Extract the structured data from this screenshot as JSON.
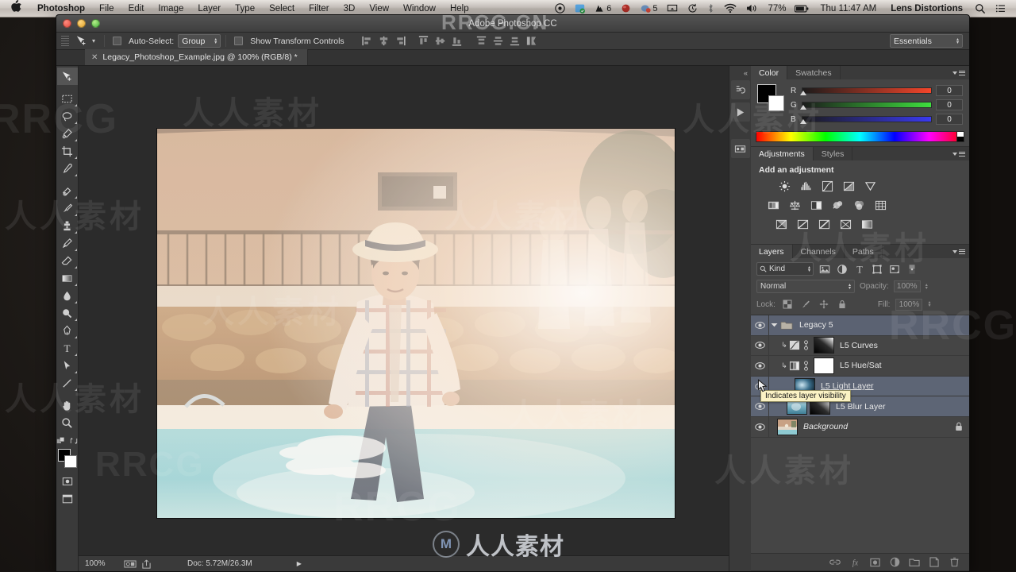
{
  "macbar": {
    "apple_icon": "apple-icon",
    "menus": [
      "Photoshop",
      "File",
      "Edit",
      "Image",
      "Layer",
      "Type",
      "Select",
      "Filter",
      "3D",
      "View",
      "Window",
      "Help"
    ],
    "status_icons": [
      "record-icon",
      "dropbox-icon",
      "app-badge-icon",
      "cloud-icon",
      "airplay-icon",
      "timemachine-icon",
      "bluetooth-icon",
      "wifi-icon",
      "volume-icon"
    ],
    "badge_counts": [
      "6",
      "5"
    ],
    "battery_percent": "77%",
    "clock": "Thu 11:47 AM",
    "user": "Lens Distortions",
    "spotlight_icon": "search-icon",
    "notification_icon": "list-icon"
  },
  "window": {
    "title": "Adobe Photoshop CC",
    "traffic": [
      "close-button",
      "minimize-button",
      "zoom-button"
    ]
  },
  "options_bar": {
    "tool_icon": "move-tool-icon",
    "auto_select_label": "Auto-Select:",
    "auto_select_value": "Group",
    "show_transform_label": "Show Transform Controls",
    "align_icons": [
      "align-left-edges-icon",
      "align-horizontal-centers-icon",
      "align-right-edges-icon",
      "align-top-edges-icon",
      "align-vertical-centers-icon",
      "align-bottom-edges-icon",
      "distribute-top-icon",
      "distribute-vertical-center-icon",
      "distribute-bottom-icon",
      "arrange-icon"
    ],
    "workspace": "Essentials"
  },
  "document_tab": {
    "close_icon": "close-icon",
    "title": "Legacy_Photoshop_Example.jpg @ 100% (RGB/8) *"
  },
  "tools": [
    {
      "name": "move-tool",
      "active": true
    },
    {
      "name": "marquee-tool",
      "active": false
    },
    {
      "name": "lasso-tool",
      "active": false
    },
    {
      "name": "quick-selection-tool",
      "active": false
    },
    {
      "name": "crop-tool",
      "active": false
    },
    {
      "name": "eyedropper-tool",
      "active": false
    },
    {
      "name": "spot-healing-tool",
      "active": false
    },
    {
      "name": "brush-tool",
      "active": false
    },
    {
      "name": "clone-stamp-tool",
      "active": false
    },
    {
      "name": "history-brush-tool",
      "active": false
    },
    {
      "name": "eraser-tool",
      "active": false
    },
    {
      "name": "gradient-tool",
      "active": false
    },
    {
      "name": "blur-tool",
      "active": false
    },
    {
      "name": "dodge-tool",
      "active": false
    },
    {
      "name": "pen-tool",
      "active": false
    },
    {
      "name": "type-tool",
      "active": false
    },
    {
      "name": "path-selection-tool",
      "active": false
    },
    {
      "name": "line-shape-tool",
      "active": false
    },
    {
      "name": "hand-tool",
      "active": false
    },
    {
      "name": "zoom-tool",
      "active": false
    }
  ],
  "status_bar": {
    "zoom": "100%",
    "doc_info": "Doc: 5.72M/26.3M",
    "icons": [
      "camera-raw-icon",
      "share-icon",
      "expand-arrow-icon"
    ]
  },
  "right_strip": {
    "collapse_icon": "collapse-panels-icon",
    "icons": [
      "history-icon",
      "play-icon",
      "actions-icon"
    ]
  },
  "color_panel": {
    "tabs": [
      {
        "label": "Color",
        "active": true
      },
      {
        "label": "Swatches",
        "active": false
      }
    ],
    "foreground": "#000000",
    "background": "#ffffff",
    "channels": [
      {
        "label": "R",
        "value": "0"
      },
      {
        "label": "G",
        "value": "0"
      },
      {
        "label": "B",
        "value": "0"
      }
    ],
    "menu_icon": "panel-menu-icon"
  },
  "adjustments_panel": {
    "tabs": [
      {
        "label": "Adjustments",
        "active": true
      },
      {
        "label": "Styles",
        "active": false
      }
    ],
    "heading": "Add an adjustment",
    "row1": [
      "brightness-contrast-icon",
      "levels-icon",
      "curves-icon",
      "exposure-icon",
      "vibrance-icon"
    ],
    "row2": [
      "hue-saturation-icon",
      "color-balance-icon",
      "black-white-icon",
      "photo-filter-icon",
      "channel-mixer-icon",
      "color-lookup-icon"
    ],
    "row3": [
      "invert-icon",
      "posterize-icon",
      "threshold-icon",
      "gradient-map-icon",
      "selective-color-icon"
    ],
    "menu_icon": "panel-menu-icon"
  },
  "layers_panel": {
    "tabs": [
      {
        "label": "Layers",
        "active": true
      },
      {
        "label": "Channels",
        "active": false
      },
      {
        "label": "Paths",
        "active": false
      }
    ],
    "menu_icon": "panel-menu-icon",
    "filter": {
      "kind_label": "Kind",
      "search_icon": "search-icon",
      "filter_icons": [
        "filter-pixel-icon",
        "filter-adjustment-icon",
        "filter-type-icon",
        "filter-shape-icon",
        "filter-smart-object-icon"
      ],
      "toggle_icon": "filter-toggle-icon"
    },
    "blend_mode": "Normal",
    "opacity_label": "Opacity:",
    "opacity_value": "100%",
    "lock_label": "Lock:",
    "lock_icons": [
      "lock-transparency-icon",
      "lock-image-icon",
      "lock-position-icon",
      "lock-all-icon"
    ],
    "fill_label": "Fill:",
    "fill_value": "100%",
    "rows": [
      {
        "name": "Legacy 5",
        "type": "group",
        "visible": true,
        "selected": true,
        "expanded": true
      },
      {
        "name": "L5 Curves",
        "type": "adjustment",
        "visible": true,
        "selected": false,
        "clipped": true,
        "mask": "gradient"
      },
      {
        "name": "L5 Hue/Sat",
        "type": "adjustment",
        "visible": true,
        "selected": false,
        "clipped": true,
        "mask": "white"
      },
      {
        "name": "L5 Light Layer",
        "type": "pixel",
        "visible": true,
        "selected": true,
        "underlined": true
      },
      {
        "name": "L5 Blur Layer",
        "type": "pixel",
        "visible": true,
        "selected": true,
        "mask": "gradient"
      },
      {
        "name": "Background",
        "type": "background",
        "visible": true,
        "selected": false,
        "locked": true,
        "italic": true
      }
    ],
    "tooltip": "Indicates layer visibility",
    "bottom_buttons": [
      "link-layers-icon",
      "layer-style-icon",
      "add-mask-icon",
      "new-adjustment-icon",
      "new-group-icon",
      "new-layer-icon",
      "delete-layer-icon"
    ]
  },
  "watermarks": {
    "top": "RRCG.CN",
    "logo_text": "人人素材",
    "logo_mark": "M",
    "tiles": [
      "人人素材",
      "RRCG"
    ]
  }
}
